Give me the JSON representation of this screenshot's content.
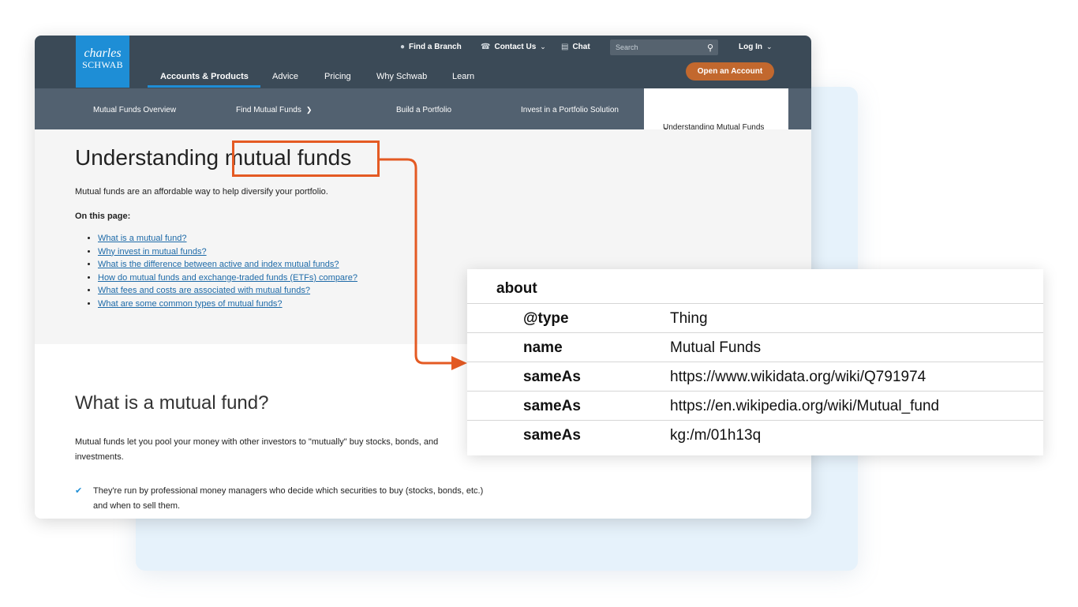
{
  "header": {
    "logo_line1": "charles",
    "logo_line2": "SCHWAB",
    "utility": {
      "find_branch": "Find a Branch",
      "contact_us": "Contact Us",
      "chat": "Chat",
      "search_placeholder": "Search",
      "log_in": "Log In"
    },
    "main_nav": [
      "Accounts & Products",
      "Advice",
      "Pricing",
      "Why Schwab",
      "Learn"
    ],
    "open_account": "Open an Account"
  },
  "sub_nav": {
    "items": [
      "Mutual Funds Overview",
      "Find Mutual Funds",
      "Build a Portfolio",
      "Invest in a Portfolio Solution"
    ],
    "active": "Understanding Mutual Funds"
  },
  "content": {
    "title_prefix": "Understanding",
    "title_highlight": "mutual funds",
    "intro": "Mutual funds are an affordable way to help diversify your portfolio.",
    "on_this_page": "On this page:",
    "toc": [
      "What is a mutual fund?",
      "Why invest in mutual funds?",
      "What is the difference between active and index mutual funds?",
      "How do mutual funds and exchange-traded funds (ETFs) compare?",
      "What fees and costs are associated with mutual funds?",
      "What are some common types of mutual funds?"
    ],
    "section_title": "What is a mutual fund?",
    "section_para_line1": "Mutual funds let you pool your money with other investors to \"mutually\" buy stocks, bonds, and",
    "section_para_line2": "investments.",
    "bullet1_line1": "They're run by professional money managers who decide which securities to buy (stocks, bonds, etc.)",
    "bullet1_line2": "and when to sell them."
  },
  "schema": {
    "heading": "about",
    "rows": [
      {
        "key": "@type",
        "value": "Thing"
      },
      {
        "key": "name",
        "value": "Mutual Funds"
      },
      {
        "key": "sameAs",
        "value": "https://www.wikidata.org/wiki/Q791974"
      },
      {
        "key": "sameAs",
        "value": "https://en.wikipedia.org/wiki/Mutual_fund"
      },
      {
        "key": "sameAs",
        "value": "kg:/m/01h13q"
      }
    ]
  },
  "colors": {
    "header_bg": "#3b4a57",
    "subnav_bg": "#526170",
    "brand_blue": "#1e8ed6",
    "cta_orange": "#c2682e",
    "highlight_orange": "#e45a23",
    "link_blue": "#1d6aa8"
  },
  "icons": [
    "location-pin-icon",
    "phone-icon",
    "chat-icon",
    "search-icon",
    "chevron-down-icon",
    "checkmark-icon"
  ]
}
